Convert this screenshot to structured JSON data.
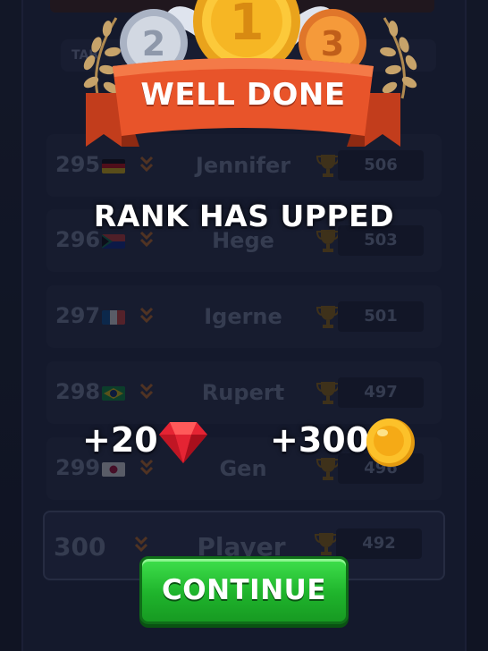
{
  "header": {
    "tab_label": "TAB"
  },
  "leaderboard": {
    "rows": [
      {
        "rank": "295",
        "name": "Jennifer",
        "score": "506",
        "flag": "germany"
      },
      {
        "rank": "296",
        "name": "Hege",
        "score": "503",
        "flag": "south-africa"
      },
      {
        "rank": "297",
        "name": "Igerne",
        "score": "501",
        "flag": "france"
      },
      {
        "rank": "298",
        "name": "Rupert",
        "score": "497",
        "flag": "brazil"
      },
      {
        "rank": "299",
        "name": "Gen",
        "score": "496",
        "flag": "japan"
      }
    ],
    "player": {
      "rank": "300",
      "name": "Player",
      "score": "492"
    }
  },
  "medals": {
    "first": "1",
    "second": "2",
    "third": "3"
  },
  "popup": {
    "banner_title": "WELL DONE",
    "subtitle": "RANK HAS UPPED",
    "gems_reward": "+20",
    "coins_reward": "+300",
    "continue_label": "CONTINUE"
  },
  "colors": {
    "banner": "#e8542a",
    "gold": "#f5b82e",
    "gem": "#e52433",
    "button_green": "#2bc93a",
    "background": "#1b2238"
  },
  "icons": [
    "chevron-down-icon",
    "trophy-icon",
    "ruby-gem-icon",
    "gold-coin-icon",
    "laurel-icon",
    "medal-icon"
  ]
}
